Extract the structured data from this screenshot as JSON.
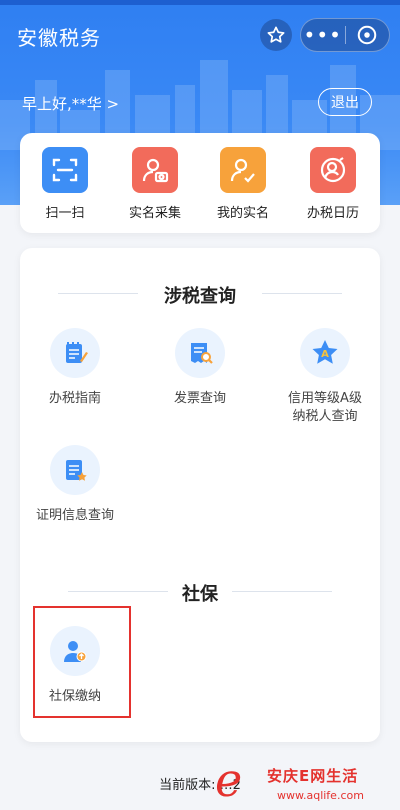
{
  "header": {
    "title": "安徽税务",
    "greeting": "早上好,**华 >",
    "logout_label": "退出",
    "more_label": "•••"
  },
  "quick_actions": [
    {
      "label": "扫一扫",
      "icon": "scan-icon",
      "color": "#3d8ef5"
    },
    {
      "label": "实名采集",
      "icon": "id-camera-icon",
      "color": "#f26b5b"
    },
    {
      "label": "我的实名",
      "icon": "my-identity-icon",
      "color": "#f7a23b"
    },
    {
      "label": "办税日历",
      "icon": "tax-calendar-icon",
      "color": "#f26b5b"
    }
  ],
  "sections": {
    "tax_query": {
      "title": "涉税查询",
      "items": [
        {
          "label": "办税指南",
          "icon": "guide-notebook-icon"
        },
        {
          "label": "发票查询",
          "icon": "invoice-search-icon"
        },
        {
          "label": "信用等级A级纳税人查询",
          "label_line1": "信用等级A级",
          "label_line2": "纳税人查询",
          "icon": "credit-a-star-icon"
        },
        {
          "label": "证明信息查询",
          "icon": "certificate-icon"
        }
      ]
    },
    "social": {
      "title": "社保",
      "items": [
        {
          "label": "社保缴纳",
          "icon": "social-insurance-user-icon"
        }
      ]
    }
  },
  "footer": {
    "version_label": "当前版本:",
    "version_value": "…2"
  },
  "watermark": {
    "letter": "e",
    "name": "安庆E网生活",
    "url": "www.aqlife.com"
  },
  "colors": {
    "header_blue": "#3a89f5",
    "accent_blue": "#3d8ef5",
    "highlight_red": "#e4322e",
    "icon_bg": "#eaf3fe"
  }
}
